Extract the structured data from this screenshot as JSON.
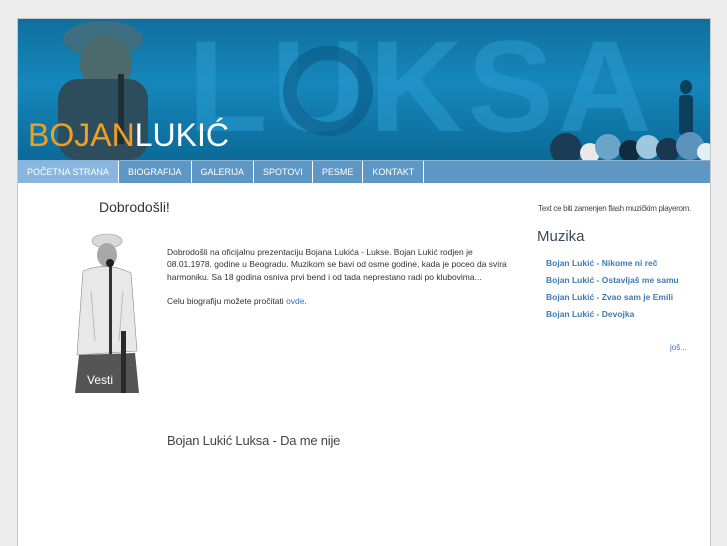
{
  "header": {
    "brand_first": "BOJAN",
    "brand_last": "LUKIĆ",
    "watermark": "LUKSA"
  },
  "nav": {
    "items": [
      {
        "label": "POČETNA STRANA",
        "active": true
      },
      {
        "label": "BIOGRAFIJA",
        "active": false
      },
      {
        "label": "GALERIJA",
        "active": false
      },
      {
        "label": "SPOTOVI",
        "active": false
      },
      {
        "label": "PESME",
        "active": false
      },
      {
        "label": "KONTAKT",
        "active": false
      }
    ]
  },
  "main": {
    "welcome_title": "Dobrodošli!",
    "photo_caption": "Vesti",
    "intro_text": "Dobrodošli na oficijalnu prezentaciju Bojana Lukića - Lukse. Bojan Lukić rodjen je 08.01.1978. godine u Beogradu. Muzikom se bavi od osme godine, kada je poceo da svira harmoniku. Sa 18 godina osniva prvi bend i od tada neprestano radi po klubovima...",
    "bio_prefix": "Celu biografiju možete pročitati ",
    "bio_link": "ovde",
    "bio_suffix": ".",
    "video_title": "Bojan Lukić Luksa - Da me nije"
  },
  "sidebar": {
    "note": "Text ce biti zamenjen flash muzičkim playerom.",
    "title": "Muzika",
    "songs": [
      "Bojan Lukić - Nikome ni reč",
      "Bojan Lukić - Ostavljaš me samu",
      "Bojan Lukić - Zvao sam je Emili",
      "Bojan Lukić - Devojka"
    ],
    "more": "još..."
  },
  "colors": {
    "header_blue": "#1687bb",
    "nav_blue": "#5f97c4",
    "nav_active": "#88b6de",
    "brand_orange": "#f0a020",
    "link_blue": "#3f7ab3"
  }
}
